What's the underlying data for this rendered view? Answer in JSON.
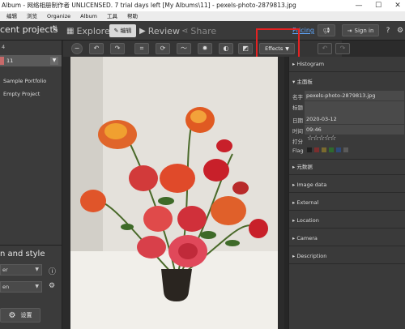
{
  "window": {
    "title": "Album - 网络相册制作者 UNLICENSED. 7 trial days left [My Albums\\11] - pexels-photo-2879813.jpg",
    "controls": [
      "—",
      "☐",
      "✕"
    ]
  },
  "menu": [
    "编辑",
    "浏览",
    "Organize",
    "Album",
    "工具",
    "帮助"
  ],
  "toolbar": {
    "recent_projects": "cent projects",
    "tabs": {
      "explore": "Explore",
      "edit": "编辑",
      "review": "Review",
      "share": "Share"
    },
    "pricing": "Pricing",
    "sign_in": "Sign in"
  },
  "left_panel": {
    "count": "4",
    "selected_album": "11",
    "albums": [
      "Sample Portfolio",
      "Empty Project"
    ],
    "style_title": "n and style",
    "select1": "er",
    "select2": "en",
    "settings_label": "设置"
  },
  "subtoolbar": {
    "effects_label": "Effects"
  },
  "right_panel": {
    "sections": {
      "histogram": "Histogram",
      "main": "主面板",
      "metadata": "元数据",
      "image_data": "Image data",
      "external": "External",
      "location": "Location",
      "camera": "Camera",
      "description": "Description"
    },
    "fields": {
      "name_label": "名字",
      "name_value": "pexels-photo-2879813.jpg",
      "title_label": "标题",
      "title_value": "",
      "date_label": "日期",
      "date_value": "2020-03-12",
      "time_label": "时间",
      "time_value": "09:46",
      "rating_label": "打分",
      "flag_label": "Flag"
    },
    "rating": 0,
    "flag_colors": [
      "#1e1e1e",
      "#7a2e2e",
      "#7a6a2e",
      "#2e6a2e",
      "#2e4a7a",
      "#5a5a5a"
    ]
  },
  "colors": {
    "highlight": "#e52222",
    "pricing_link": "#5fa8ff"
  }
}
